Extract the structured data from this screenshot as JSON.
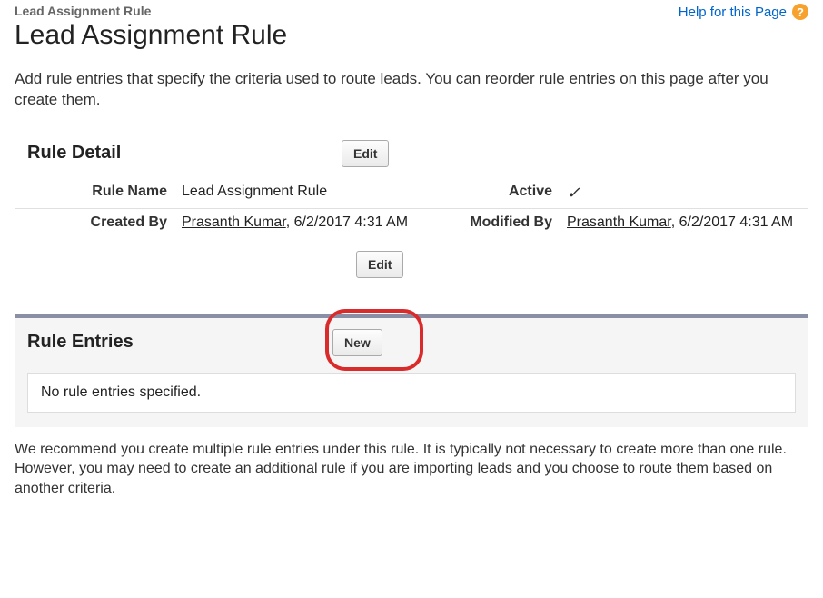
{
  "header": {
    "breadcrumb": "Lead Assignment Rule",
    "title": "Lead Assignment Rule",
    "help_label": "Help for this Page"
  },
  "intro": "Add rule entries that specify the criteria used to route leads. You can reorder rule entries on this page after you create them.",
  "detail": {
    "section_title": "Rule Detail",
    "edit_label": "Edit",
    "rule_name_label": "Rule Name",
    "rule_name_value": "Lead Assignment Rule",
    "active_label": "Active",
    "active_value": true,
    "created_by_label": "Created By",
    "created_by_user": "Prasanth Kumar",
    "created_by_time": ", 6/2/2017 4:31 AM",
    "modified_by_label": "Modified By",
    "modified_by_user": "Prasanth Kumar",
    "modified_by_time": ", 6/2/2017 4:31 AM"
  },
  "entries": {
    "section_title": "Rule Entries",
    "new_label": "New",
    "empty_message": "No rule entries specified."
  },
  "footer": "We recommend you create multiple rule entries under this rule. It is typically not necessary to create more than one rule. However, you may need to create an additional rule if you are importing leads and you choose to route them based on another criteria."
}
